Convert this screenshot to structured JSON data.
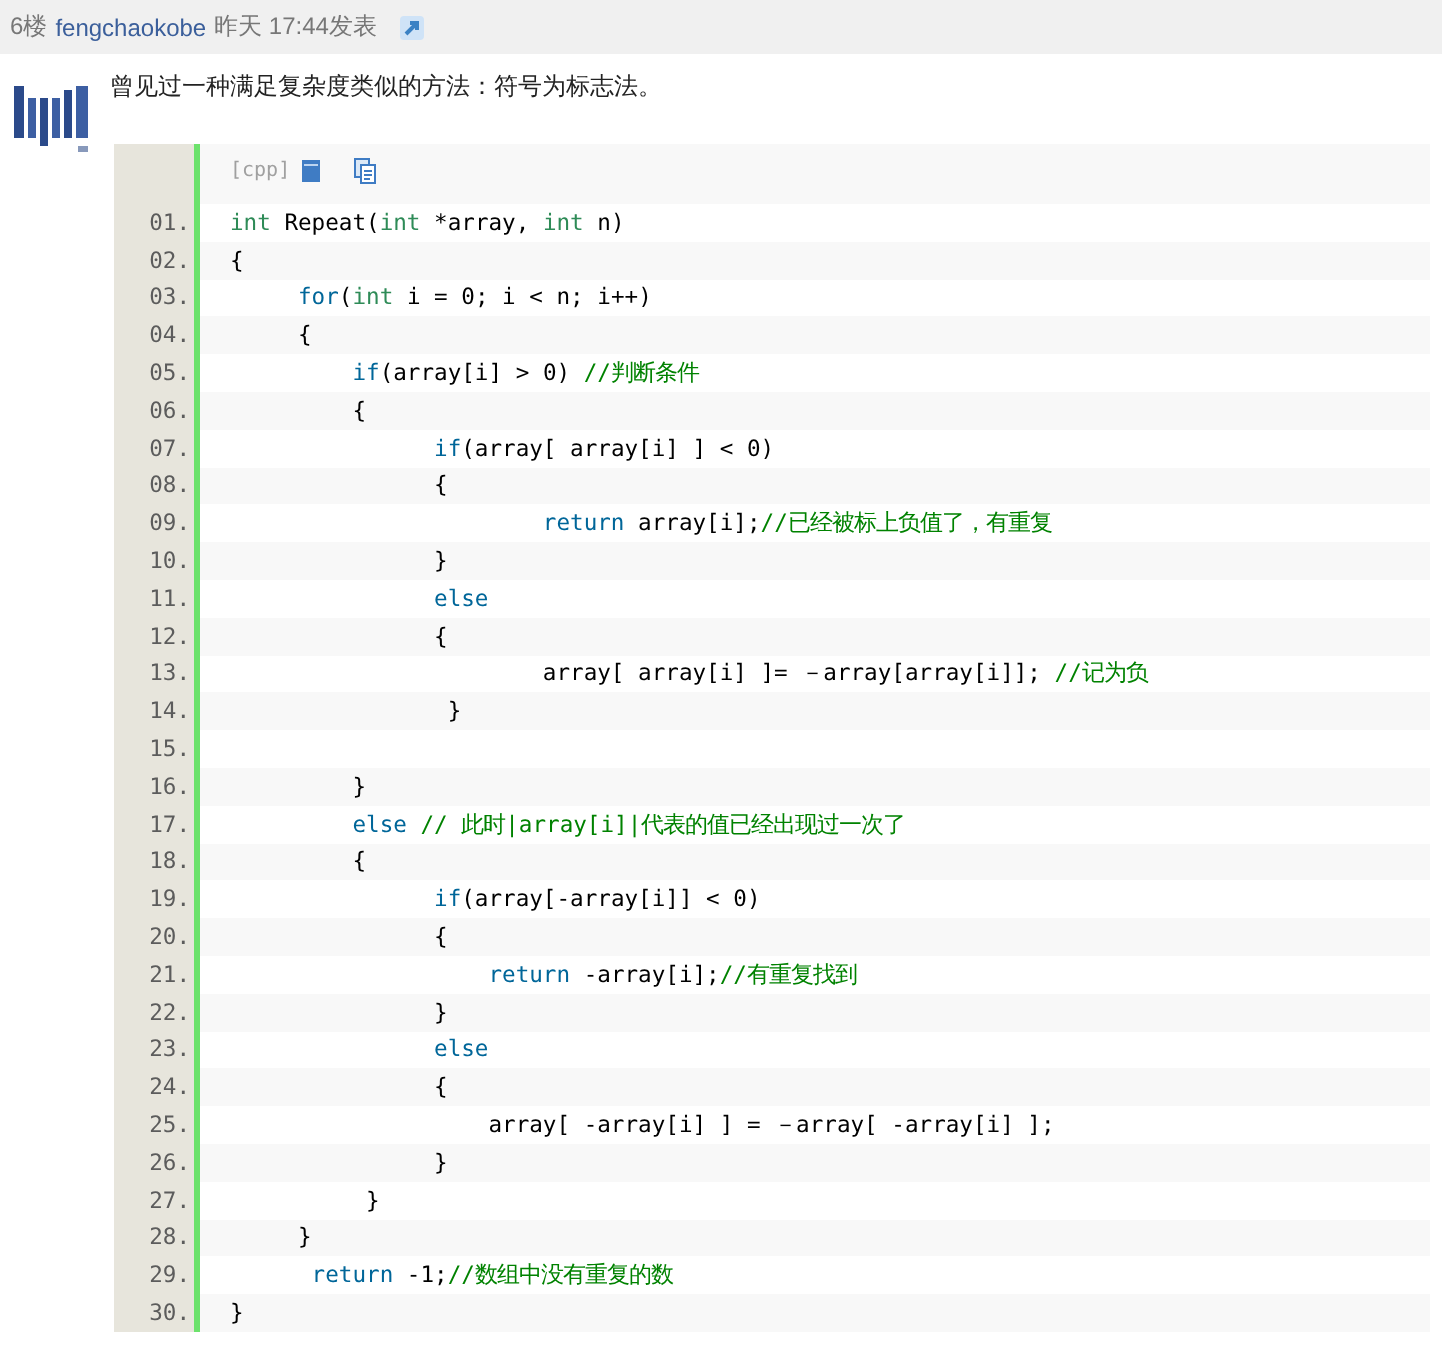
{
  "post_header": {
    "floor": "6楼",
    "username": "fengchaokobe",
    "time": "昨天 17:44发表"
  },
  "comment": "曾见过一种满足复杂度类似的方法：符号为标志法。",
  "code_block": {
    "language": "[cpp]",
    "lines": [
      {
        "number": "01.",
        "segments": [
          {
            "kind": "type",
            "text": "int"
          },
          {
            "kind": "plain",
            "text": " Repeat("
          },
          {
            "kind": "type",
            "text": "int"
          },
          {
            "kind": "plain",
            "text": " *array, "
          },
          {
            "kind": "type",
            "text": "int"
          },
          {
            "kind": "plain",
            "text": " n)"
          }
        ]
      },
      {
        "number": "02.",
        "segments": [
          {
            "kind": "plain",
            "text": "{"
          }
        ]
      },
      {
        "number": "03.",
        "segments": [
          {
            "kind": "keyword",
            "text": "     for"
          },
          {
            "kind": "plain",
            "text": "("
          },
          {
            "kind": "type",
            "text": "int"
          },
          {
            "kind": "plain",
            "text": " i = 0; i < n; i++)"
          }
        ]
      },
      {
        "number": "04.",
        "segments": [
          {
            "kind": "plain",
            "text": "     {"
          }
        ]
      },
      {
        "number": "05.",
        "segments": [
          {
            "kind": "keyword",
            "text": "         if"
          },
          {
            "kind": "plain",
            "text": "(array[i] > 0) "
          },
          {
            "kind": "comment",
            "text": "//判断条件"
          }
        ]
      },
      {
        "number": "06.",
        "segments": [
          {
            "kind": "plain",
            "text": "         {"
          }
        ]
      },
      {
        "number": "07.",
        "segments": [
          {
            "kind": "keyword",
            "text": "               if"
          },
          {
            "kind": "plain",
            "text": "(array[ array[i] ] < 0)"
          }
        ]
      },
      {
        "number": "08.",
        "segments": [
          {
            "kind": "plain",
            "text": "               {"
          }
        ]
      },
      {
        "number": "09.",
        "segments": [
          {
            "kind": "keyword",
            "text": "                       return"
          },
          {
            "kind": "plain",
            "text": " array[i];"
          },
          {
            "kind": "comment",
            "text": "//已经被标上负值了，有重复"
          }
        ]
      },
      {
        "number": "10.",
        "segments": [
          {
            "kind": "plain",
            "text": "               }"
          }
        ]
      },
      {
        "number": "11.",
        "segments": [
          {
            "kind": "keyword",
            "text": "               else"
          }
        ]
      },
      {
        "number": "12.",
        "segments": [
          {
            "kind": "plain",
            "text": "               {"
          }
        ]
      },
      {
        "number": "13.",
        "segments": [
          {
            "kind": "plain",
            "text": "                       array[ array[i] ]= －array[array[i]]; "
          },
          {
            "kind": "comment",
            "text": "//记为负"
          }
        ]
      },
      {
        "number": "14.",
        "segments": [
          {
            "kind": "plain",
            "text": "                }"
          }
        ]
      },
      {
        "number": "15."
      },
      {
        "number": "16.",
        "segments": [
          {
            "kind": "plain",
            "text": "         }"
          }
        ]
      },
      {
        "number": "17.",
        "segments": [
          {
            "kind": "keyword",
            "text": "         else"
          },
          {
            "kind": "comment",
            "text": " // 此时|array[i]|代表的值已经出现过一次了"
          }
        ]
      },
      {
        "number": "18.",
        "segments": [
          {
            "kind": "plain",
            "text": "         {"
          }
        ]
      },
      {
        "number": "19.",
        "segments": [
          {
            "kind": "keyword",
            "text": "               if"
          },
          {
            "kind": "plain",
            "text": "(array[-array[i]] < 0)"
          }
        ]
      },
      {
        "number": "20.",
        "segments": [
          {
            "kind": "plain",
            "text": "               {"
          }
        ]
      },
      {
        "number": "21.",
        "segments": [
          {
            "kind": "keyword",
            "text": "                   return"
          },
          {
            "kind": "plain",
            "text": " -array[i];"
          },
          {
            "kind": "comment",
            "text": "//有重复找到"
          }
        ]
      },
      {
        "number": "22.",
        "segments": [
          {
            "kind": "plain",
            "text": "               }"
          }
        ]
      },
      {
        "number": "23.",
        "segments": [
          {
            "kind": "keyword",
            "text": "               else"
          }
        ]
      },
      {
        "number": "24.",
        "segments": [
          {
            "kind": "plain",
            "text": "               {"
          }
        ]
      },
      {
        "number": "25.",
        "segments": [
          {
            "kind": "plain",
            "text": "                   array[ -array[i] ] = －array[ -array[i] ];"
          }
        ]
      },
      {
        "number": "26.",
        "segments": [
          {
            "kind": "plain",
            "text": "               }"
          }
        ]
      },
      {
        "number": "27.",
        "segments": [
          {
            "kind": "plain",
            "text": "          }"
          }
        ]
      },
      {
        "number": "28.",
        "segments": [
          {
            "kind": "plain",
            "text": "     }"
          }
        ]
      },
      {
        "number": "29.",
        "segments": [
          {
            "kind": "keyword",
            "text": "      return"
          },
          {
            "kind": "plain",
            "text": " -1;"
          },
          {
            "kind": "comment",
            "text": "//数组中没有重复的数"
          }
        ]
      },
      {
        "number": "30.",
        "segments": [
          {
            "kind": "plain",
            "text": "}"
          }
        ]
      }
    ]
  }
}
